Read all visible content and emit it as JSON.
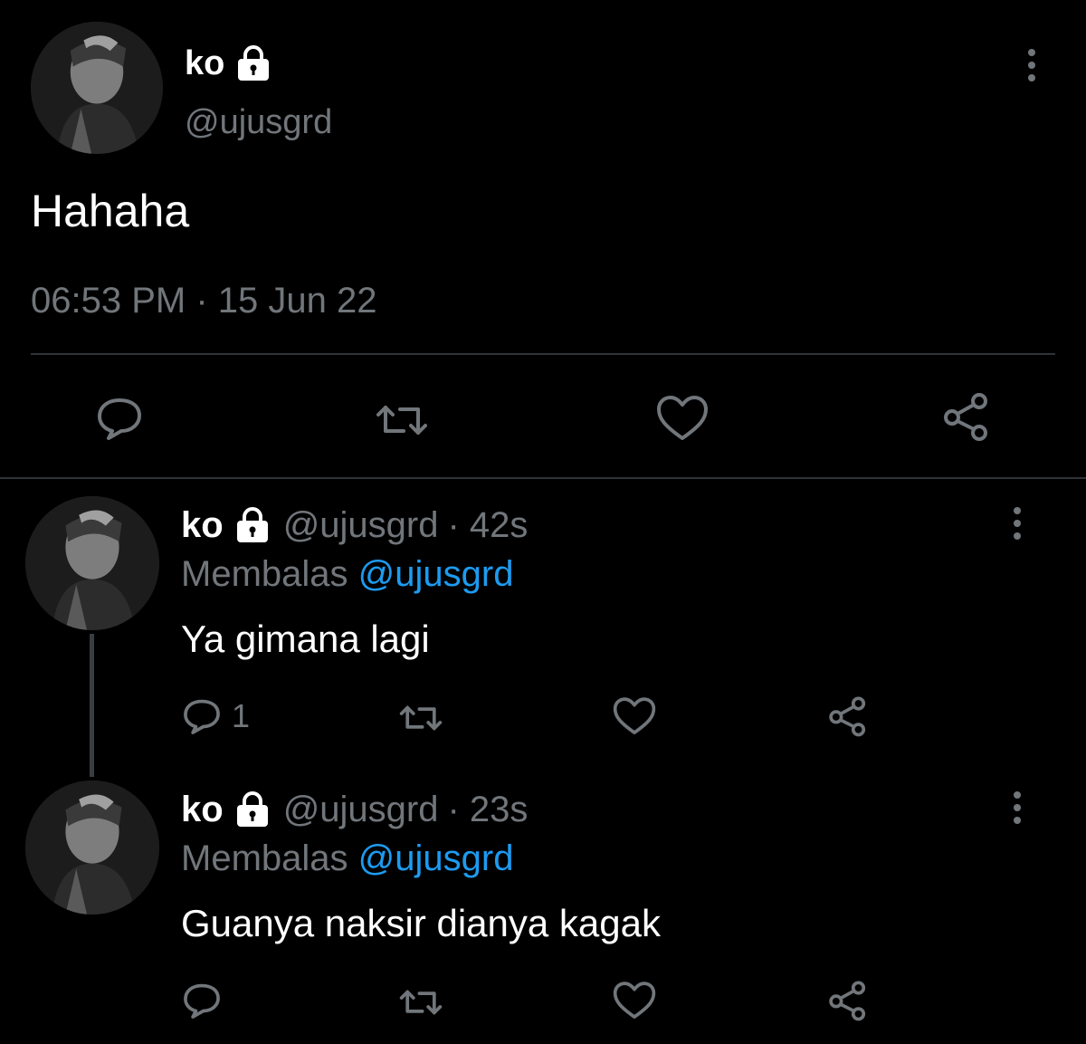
{
  "main_tweet": {
    "display_name": "ko",
    "handle": "@ujusgrd",
    "text": "Hahaha",
    "timestamp": "06:53 PM · 15 Jun 22",
    "actions": [
      "reply-icon",
      "retweet-icon",
      "like-icon",
      "share-icon"
    ]
  },
  "replies": [
    {
      "display_name": "ko",
      "handle": "@ujusgrd",
      "time": "· 42s",
      "replying_label": "Membalas",
      "replying_to": "@ujusgrd",
      "text": "Ya gimana lagi",
      "reply_count": "1"
    },
    {
      "display_name": "ko",
      "handle": "@ujusgrd",
      "time": "· 23s",
      "replying_label": "Membalas",
      "replying_to": "@ujusgrd",
      "text": "Guanya naksir dianya kagak",
      "reply_count": ""
    }
  ],
  "colors": {
    "background": "#000000",
    "text": "#e7e9ea",
    "muted": "#71767b",
    "link": "#1d9bf0",
    "divider": "#2f3336"
  }
}
